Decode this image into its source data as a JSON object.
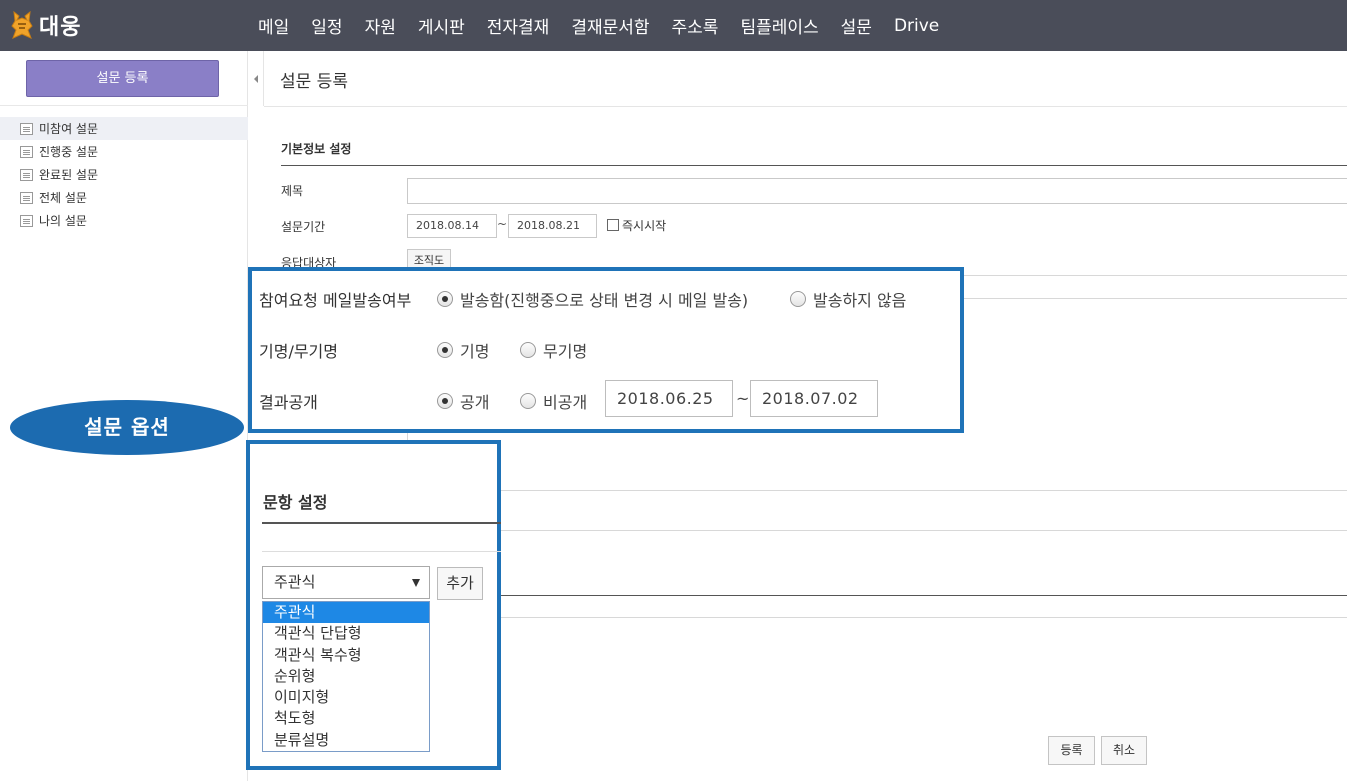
{
  "logo": {
    "text": "대웅",
    "icon": "daewoong-bear-logo"
  },
  "nav": [
    "메일",
    "일정",
    "자원",
    "게시판",
    "전자결재",
    "결재문서함",
    "주소록",
    "팀플레이스",
    "설문",
    "Drive"
  ],
  "sidebar": {
    "register_button": "설문 등록",
    "items": [
      {
        "label": "미참여 설문",
        "active": true
      },
      {
        "label": "진행중 설문",
        "active": false
      },
      {
        "label": "완료된 설문",
        "active": false
      },
      {
        "label": "전체 설문",
        "active": false
      },
      {
        "label": "나의 설문",
        "active": false
      }
    ]
  },
  "page": {
    "title": "설문 등록"
  },
  "basic_info": {
    "section_title": "기본정보 설정",
    "title_label": "제목",
    "title_value": "",
    "period_label": "설문기간",
    "period_start": "2018.08.14",
    "period_end": "2018.08.21",
    "tilde": "~",
    "immediate_start_label": "즉시시작",
    "immediate_start_checked": false,
    "target_label": "응답대상자",
    "org_chart_button": "조직도"
  },
  "options": {
    "mail_label": "참여요청 메일발송여부",
    "mail_send": "발송함(진행중으로 상태 변경 시 메일 발송)",
    "mail_no_send": "발송하지 않음",
    "mail_selected": "send",
    "name_label": "기명/무기명",
    "named": "기명",
    "anonymous": "무기명",
    "name_selected": "named",
    "result_label": "결과공개",
    "public": "공개",
    "private": "비공개",
    "result_selected": "public",
    "result_start": "2018.06.25",
    "result_end": "2018.07.02",
    "tilde": "~"
  },
  "callout": {
    "text": "설문 옵션",
    "color": "#1c6bb0"
  },
  "questions": {
    "section_title": "문항 설정",
    "selected_type": "주관식",
    "add_button": "추가",
    "type_options": [
      "주관식",
      "객관식 단답형",
      "객관식 복수형",
      "순위형",
      "이미지형",
      "척도형",
      "분류설명"
    ]
  },
  "footer": {
    "register_button": "등록",
    "cancel_button": "취소"
  },
  "colors": {
    "topbar": "#4a4d59",
    "highlight_border": "#1f73b8",
    "register_button": "#8a7fc7",
    "dropdown_selected": "#1e88e5"
  }
}
